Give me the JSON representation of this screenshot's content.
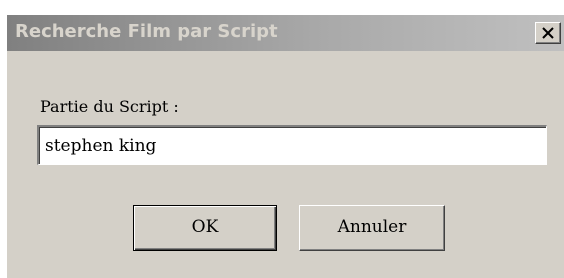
{
  "window": {
    "title": "Recherche Film par Script",
    "close_icon": "close-icon"
  },
  "form": {
    "label": "Partie du Script :",
    "input_value": "stephen king"
  },
  "buttons": {
    "ok_label": "OK",
    "cancel_label": "Annuler"
  },
  "colors": {
    "dialog_background": "#d4d0c8",
    "titlebar_start": "#808080",
    "titlebar_end": "#c0c0c0",
    "title_text": "#d8d4cc"
  }
}
